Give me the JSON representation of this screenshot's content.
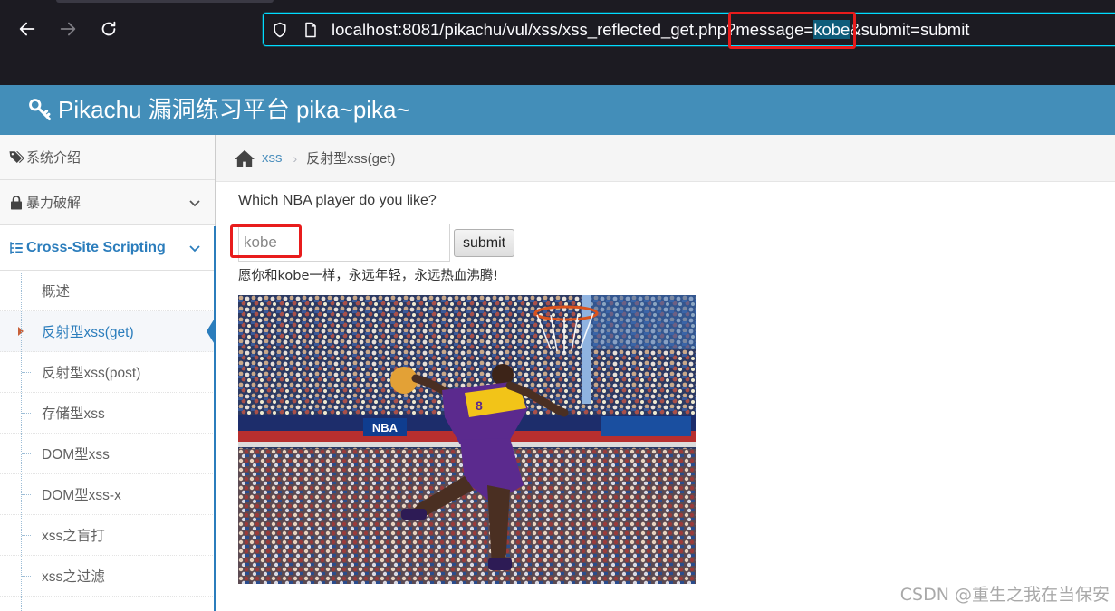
{
  "browser": {
    "url_before": "localhost:8081/pikachu/vul/xss/xss_reflected_get.php?message=",
    "url_selected": "kobe",
    "url_after": "&submit=submit",
    "icons": [
      "back-arrow-icon",
      "forward-arrow-icon",
      "reload-icon",
      "shield-icon",
      "page-icon"
    ]
  },
  "header": {
    "title": "Pikachu 漏洞练习平台 pika~pika~",
    "brand_color": "#438eb9"
  },
  "sidebar": {
    "items": [
      {
        "label": "系统介绍",
        "icon": "tags-icon"
      },
      {
        "label": "暴力破解",
        "icon": "lock-icon"
      },
      {
        "label": "Cross-Site Scripting",
        "icon": "list-tree-icon"
      }
    ],
    "subitems": [
      {
        "label": "概述"
      },
      {
        "label": "反射型xss(get)"
      },
      {
        "label": "反射型xss(post)"
      },
      {
        "label": "存储型xss"
      },
      {
        "label": "DOM型xss"
      },
      {
        "label": "DOM型xss-x"
      },
      {
        "label": "xss之盲打"
      },
      {
        "label": "xss之过滤"
      }
    ],
    "active_color": "#2b7dbc"
  },
  "breadcrumb": {
    "link": "xss",
    "current": "反射型xss(get)"
  },
  "main": {
    "question": "Which NBA player do you like?",
    "input_value": "kobe",
    "submit_label": "submit",
    "result_text": "愿你和kobe一样，永远年轻，永远热血沸腾!"
  },
  "watermark": "CSDN @重生之我在当保安"
}
